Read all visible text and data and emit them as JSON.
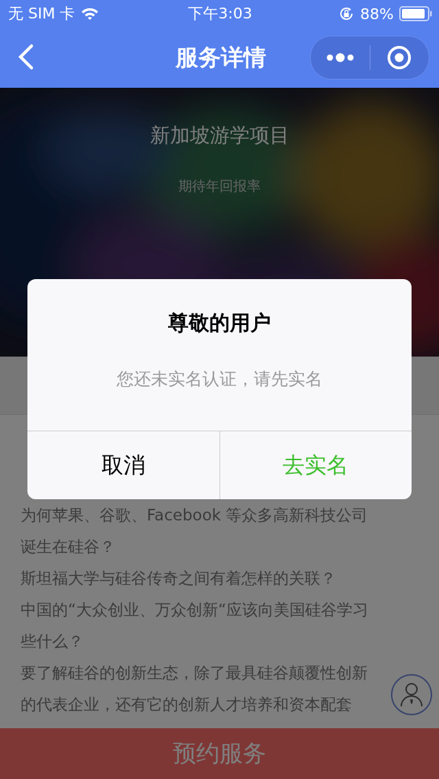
{
  "status_bar": {
    "carrier": "无 SIM 卡",
    "time": "下午3:03",
    "battery": "88%"
  },
  "nav": {
    "title": "服务详情"
  },
  "hero": {
    "title": "新加坡游学项目",
    "subtitle": "期待年回报率"
  },
  "article": {
    "lines": [
      "为何苹果、谷歌、Facebook 等众多高新科技公司",
      "诞生在硅谷？",
      "斯坦福大学与硅谷传奇之间有着怎样的关联？",
      "中国的“大众创业、万众创新“应该向美国硅谷学习",
      "些什么？",
      "要了解硅谷的创新生态，除了最具硅谷颠覆性创新",
      "的代表企业，还有它的创新人才培养和资本配套"
    ]
  },
  "bottom_button": {
    "label": "预约服务"
  },
  "dialog": {
    "title": "尊敬的用户",
    "message": "您还未实名认证，请先实名",
    "buttons": [
      {
        "label": "取消",
        "kind": "cancel"
      },
      {
        "label": "去实名",
        "kind": "confirm"
      }
    ]
  }
}
